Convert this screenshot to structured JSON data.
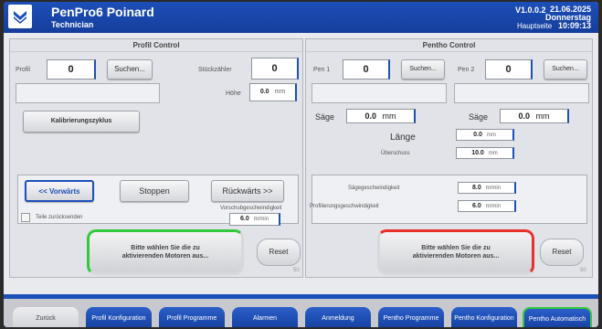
{
  "header": {
    "title": "PenPro6 Poinard",
    "user": "Technician",
    "version": "V1.0.0.2",
    "date": "21.06.2025",
    "weekday": "Donnerstag",
    "time": "10:09:13",
    "page": "Hauptseite"
  },
  "profil": {
    "title": "Profil Control",
    "profil_label": "Profil",
    "profil_value": "0",
    "search_label": "Suchen...",
    "counter_label": "Stückzähler",
    "counter_value": "0",
    "height_label": "Höhe",
    "height_value": "0.0",
    "height_unit": "mm",
    "calib_label": "Kalibrierungszyklus",
    "forward_label": "<< Vorwärts",
    "stop_label": "Stoppen",
    "backward_label": "Rückwärts >>",
    "return_label": "Teile zurücksenden",
    "feed_label": "Vorschubgeschwindigkeit",
    "feed_value": "6.0",
    "feed_unit": "m/min",
    "motor_label": "Bitte wählen Sie die zu aktivierenden Motoren aus...",
    "reset_label": "Reset",
    "reset_count": "50"
  },
  "pentho": {
    "title": "Pentho Control",
    "pen1_label": "Pen 1",
    "pen1_value": "0",
    "pen2_label": "Pen 2",
    "pen2_value": "0",
    "search_label": "Suchen...",
    "saw1_label": "Säge",
    "saw1_value": "0.0",
    "saw2_label": "Säge",
    "saw2_value": "0.0",
    "mm": "mm",
    "length_label": "Länge",
    "length_value": "0.0",
    "overhang_label": "Überschuss",
    "overhang_value": "10.0",
    "saw_speed_label": "Sägegeschwindigkeit",
    "saw_speed_value": "8.0",
    "profile_speed_label": "Profilierungsgeschwindigkeit",
    "profile_speed_value": "6.0",
    "speed_unit": "m/min",
    "motor_label": "Bitte wählen Sie die zu aktivierenden Motoren aus...",
    "reset_label": "Reset",
    "reset_count": "50"
  },
  "nav": {
    "back": "Zurück",
    "profil_konf": "Profil Konfiguration",
    "profil_prog": "Profil Programme",
    "alarms": "Alarmen",
    "login": "Anmeldung",
    "pentho_prog": "Pentho Programme",
    "pentho_konf": "Pentho Konfiguration",
    "pentho_auto": "Pentho Automatisch"
  },
  "colors": {
    "accent": "#1d4fb8",
    "green": "#32c93c",
    "red": "#e8302c"
  }
}
